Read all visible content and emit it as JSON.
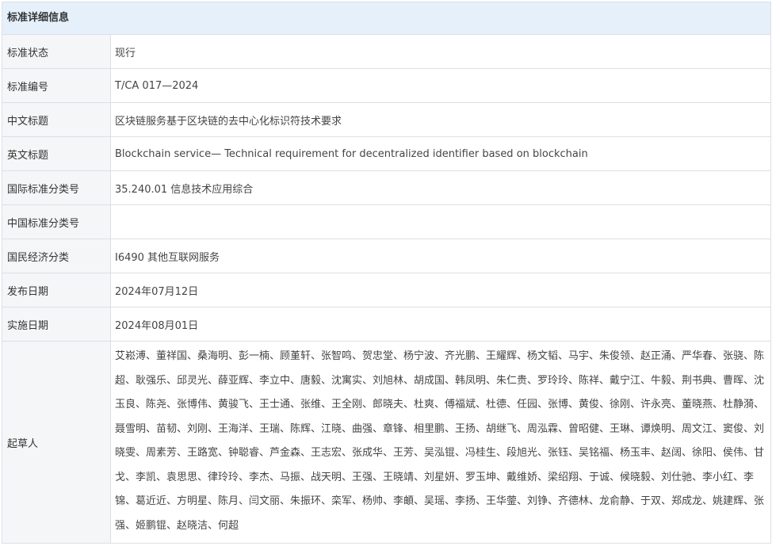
{
  "header": {
    "title": "标准详细信息"
  },
  "rows": [
    {
      "label": "标准状态",
      "value": "现行"
    },
    {
      "label": "标准编号",
      "value": "T/CA 017—2024"
    },
    {
      "label": "中文标题",
      "value": "区块链服务基于区块链的去中心化标识符技术要求"
    },
    {
      "label": "英文标题",
      "value": "Blockchain service— Technical requirement for decentralized identifier based on blockchain"
    },
    {
      "label": "国际标准分类号",
      "value": "35.240.01 信息技术应用综合"
    },
    {
      "label": "中国标准分类号",
      "value": ""
    },
    {
      "label": "国民经济分类",
      "value": "I6490 其他互联网服务"
    },
    {
      "label": "发布日期",
      "value": "2024年07月12日"
    },
    {
      "label": "实施日期",
      "value": "2024年08月01日"
    }
  ],
  "drafters": {
    "label": "起草人",
    "value": "艾崧溥、董祥国、桑海明、彭一楠、顾堇轩、张智鸣、贺忠堂、杨宁波、齐光鹏、王耀辉、杨文韬、马宇、朱俊领、赵正涌、严华春、张骁、陈超、耿强乐、邱灵光、薛亚辉、李立中、唐毅、沈寓实、刘旭林、胡成国、韩凤明、朱仁贵、罗玲玲、陈祥、戴宁江、牛毅、荆书典、曹晖、沈玉良、陈尧、张博伟、黄骏飞、王士通、张维、王全刚、郎晓夫、杜爽、傅福斌、杜德、任园、张博、黄俊、徐刚、许永亮、董晓燕、杜静漪、聂雪明、苗韧、刘刚、王海洋、王瑞、陈辉、江晓、曲强、章锋、相里鹏、王扬、胡继飞、周泓霖、曾昭健、王琳、谭焕明、周文江、窦俊、刘晓雯、周素芳、王路宽、钟聪睿、芦金森、王志宏、张成华、王芳、吴泓锟、冯桂生、段旭光、张钰、吴铭福、杨玉丰、赵阔、徐阳、侯伟、甘戈、李凯、袁思思、律玲玲、李杰、马振、战天明、王强、王晓靖、刘星妍、罗玉坤、戴维娇、梁绍翔、于诚、候晓毅、刘仕驰、李小红、李锦、葛近近、方明星、陈月、闫文丽、朱振环、栾军、杨帅、李頔、吴瑶、李扬、王华蓥、刘铮、齐德林、龙俞静、于双、郑成龙、姚建辉、张强、姬鹏锟、赵晓洁、何超"
  }
}
